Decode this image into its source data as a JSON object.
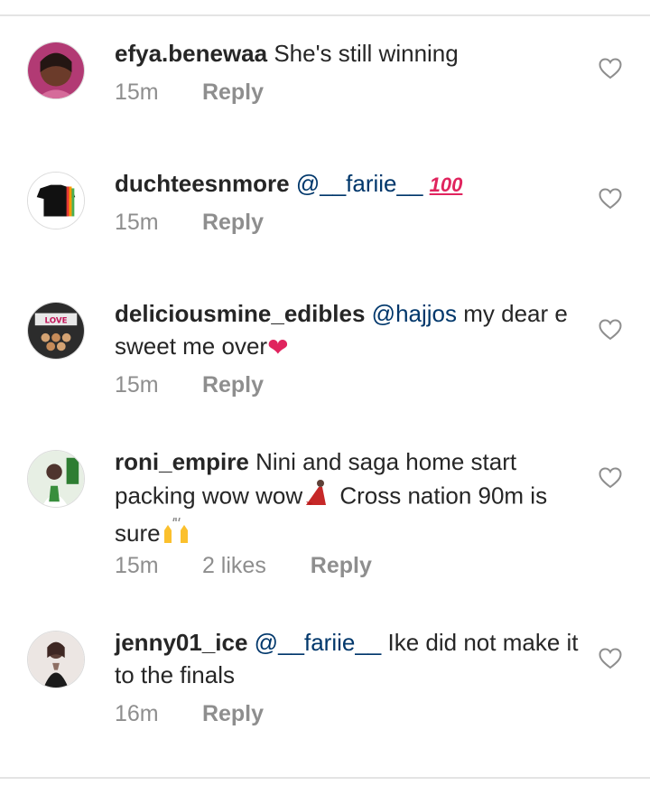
{
  "comments": [
    {
      "username": "efya.benewaa",
      "mention": "",
      "text": "She's still winning",
      "text_cont": "",
      "time": "15m",
      "likes": "",
      "reply": "Reply",
      "emoji": "",
      "emoji_end": ""
    },
    {
      "username": "duchteesnmore",
      "mention": "@__fariie__",
      "text": "",
      "text_cont": "",
      "time": "15m",
      "likes": "",
      "reply": "Reply",
      "emoji": "",
      "emoji_end": "100-emoji"
    },
    {
      "username": "deliciousmine_edibles",
      "mention": "@hajjos",
      "text": "my dear e sweet me over",
      "text_cont": "",
      "time": "15m",
      "likes": "",
      "reply": "Reply",
      "emoji": "",
      "emoji_end": "red-heart-emoji"
    },
    {
      "username": "roni_empire",
      "mention": "",
      "text": "Nini and saga home start packing wow wow",
      "text_cont": "Cross nation 90m is sure",
      "time": "15m",
      "likes": "2 likes",
      "reply": "Reply",
      "emoji": "dancer-emoji",
      "emoji_end": "raised-hands-emoji"
    },
    {
      "username": "jenny01_ice",
      "mention": "@__fariie__",
      "text": "Ike did not make it to the finals",
      "text_cont": "",
      "time": "16m",
      "likes": "",
      "reply": "Reply",
      "emoji": "",
      "emoji_end": ""
    }
  ],
  "colors": {
    "text": "#262626",
    "meta": "#8e8e8e",
    "mention": "#00376b",
    "divider": "#e4e4e4"
  },
  "icons": {
    "like": "heart-outline-icon"
  }
}
